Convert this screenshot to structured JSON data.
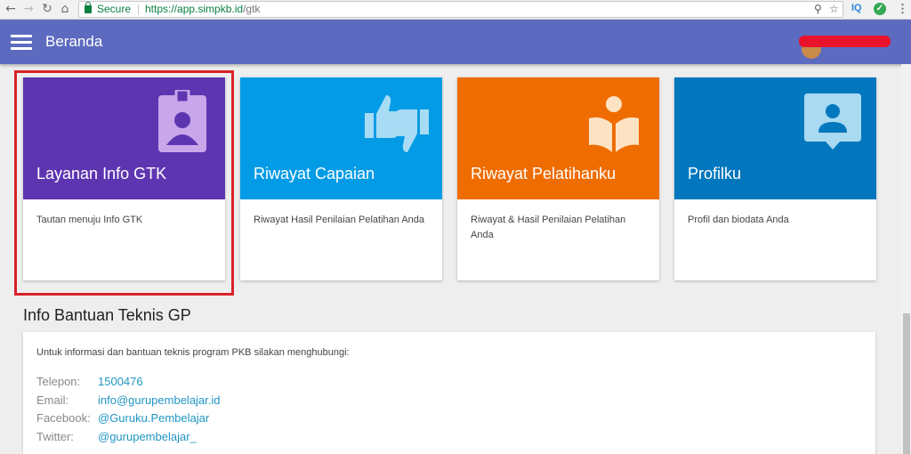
{
  "browser": {
    "secure_label": "Secure",
    "url_host": "https://app.simpkb.id",
    "url_path": "/gtk",
    "extension_iq": "IQ"
  },
  "appbar": {
    "title": "Beranda"
  },
  "cards": [
    {
      "title": "Layanan Info GTK",
      "description": "Tautan menuju Info GTK",
      "color": "#5e35b1",
      "icon": "id-badge-icon"
    },
    {
      "title": "Riwayat Capaian",
      "description": "Riwayat Hasil Penilaian Pelatihan Anda",
      "color": "#039be5",
      "icon": "thumbs-up-down-icon"
    },
    {
      "title": "Riwayat Pelatihanku",
      "description": "Riwayat & Hasil Penilaian Pelatihan Anda",
      "color": "#ef6c00",
      "icon": "reading-book-icon"
    },
    {
      "title": "Profilku",
      "description": "Profil dan biodata Anda",
      "color": "#0277bd",
      "icon": "profile-card-icon"
    }
  ],
  "support": {
    "title": "Info Bantuan Teknis GP",
    "intro": "Untuk informasi dan bantuan teknis program PKB silakan menghubungi:",
    "contacts": [
      {
        "label": "Telepon:",
        "value": "1500476"
      },
      {
        "label": "Email:",
        "value": "info@gurupembelajar.id"
      },
      {
        "label": "Facebook:",
        "value": "@Guruku.Pembelajar"
      },
      {
        "label": "Twitter:",
        "value": "@gurupembelajar_"
      }
    ]
  }
}
